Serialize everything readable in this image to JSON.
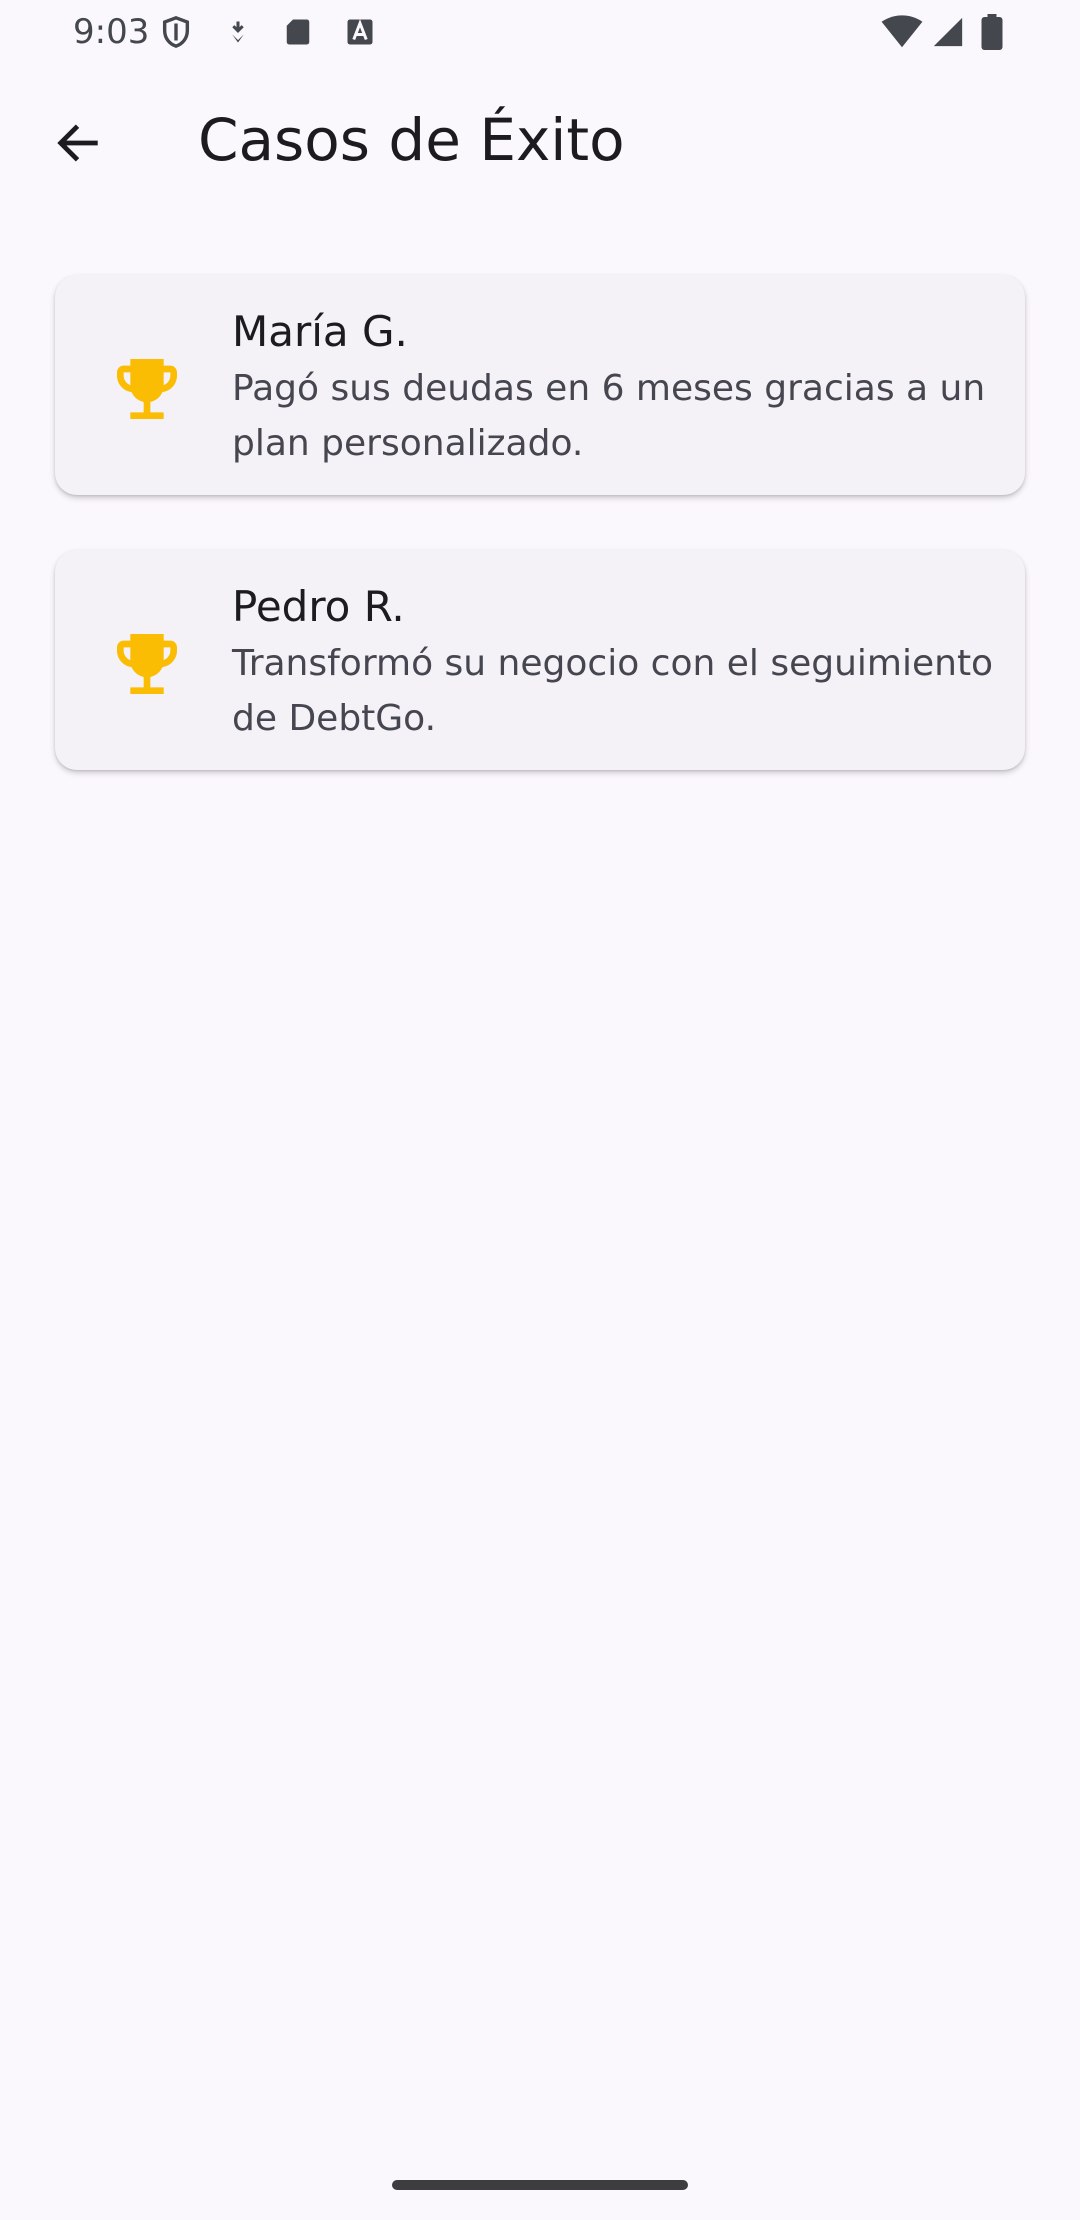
{
  "status_bar": {
    "time": "9:03",
    "left_icons": [
      "shield-icon",
      "nfc-download-icon",
      "sd-card-icon",
      "font-a-icon"
    ],
    "right_icons": [
      "wifi-icon",
      "signal-icon",
      "battery-icon"
    ]
  },
  "app_bar": {
    "back_icon": "arrow-left-icon",
    "title": "Casos de Éxito"
  },
  "cases": [
    {
      "icon": "trophy-icon",
      "name": "María G.",
      "description": "Pagó sus deudas en 6 meses gracias a un plan personalizado."
    },
    {
      "icon": "trophy-icon",
      "name": "Pedro R.",
      "description": "Transformó su negocio con el seguimiento de DebtGo."
    }
  ],
  "colors": {
    "background": "#faf7fd",
    "card": "#f4f1f7",
    "trophy": "#fbbc04",
    "text_primary": "#1c1b1f",
    "text_secondary": "#45464f"
  }
}
